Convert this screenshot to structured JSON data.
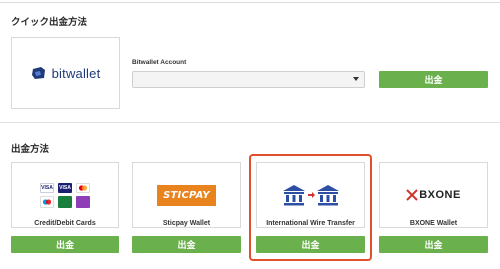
{
  "quick": {
    "title": "クイック出金方法",
    "logo_text": "bitwallet",
    "account_label": "Bitwallet Account",
    "select_value": "",
    "withdraw_label": "出金"
  },
  "methods": {
    "title": "出金方法",
    "items": [
      {
        "name": "Credit/Debit Cards",
        "button": "出金"
      },
      {
        "name": "Sticpay Wallet",
        "button": "出金",
        "logo_text": "STICPAY"
      },
      {
        "name": "International Wire Transfer",
        "button": "出金"
      },
      {
        "name": "BXONE Wallet",
        "button": "出金",
        "logo_text": "BXONE"
      }
    ],
    "card_labels": [
      "VISA",
      "VISA",
      "",
      "",
      "",
      ""
    ]
  },
  "colors": {
    "accent_green": "#6ab04c",
    "highlight": "#e0502a",
    "brand_navy": "#1e3a78",
    "sticpay_orange": "#e8831d",
    "bxone_red": "#d0342c"
  }
}
